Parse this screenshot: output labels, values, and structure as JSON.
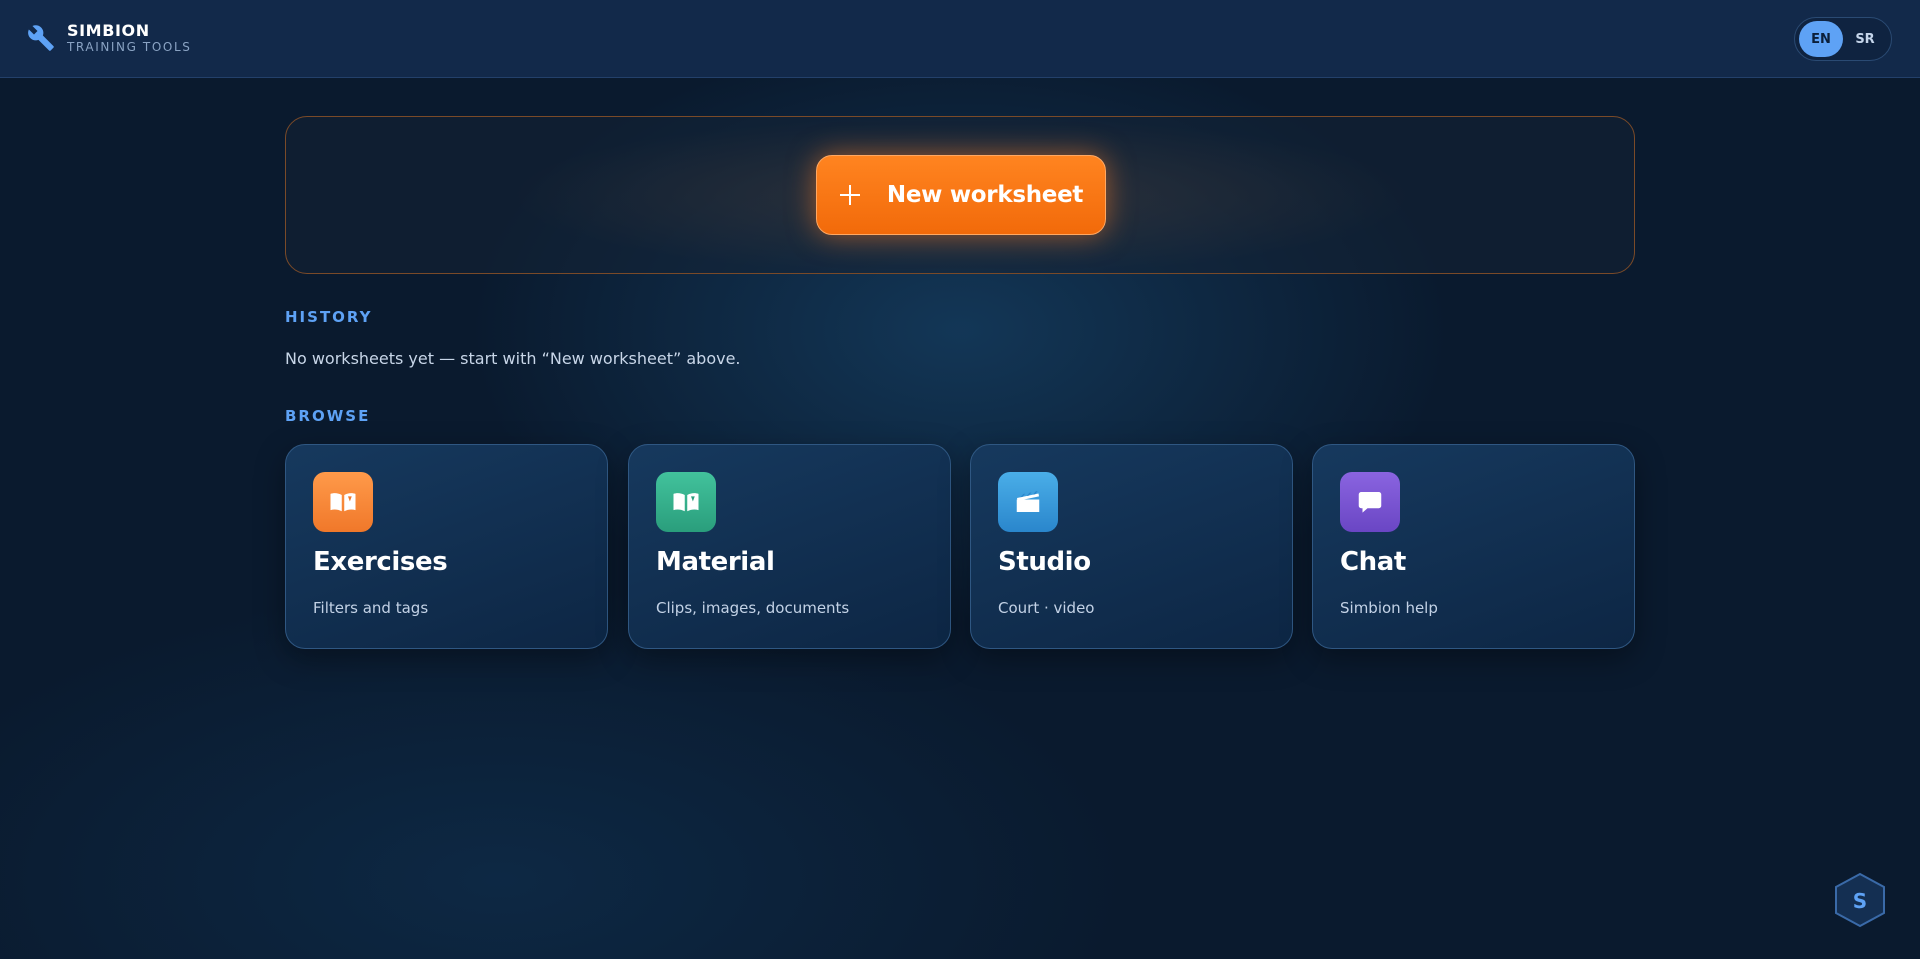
{
  "brand": {
    "title": "SIMBION",
    "subtitle": "TRAINING TOOLS",
    "icon": "wrench-icon"
  },
  "language": {
    "options": [
      {
        "code": "EN",
        "active": true
      },
      {
        "code": "SR",
        "active": false
      }
    ],
    "active_color": "#5ea2f5"
  },
  "hero": {
    "new_button_label": "New worksheet",
    "icon": "plus-icon",
    "accent": "#f97316"
  },
  "history": {
    "title": "HISTORY",
    "empty_text": "No worksheets yet — start with “New worksheet” above."
  },
  "browse": {
    "title": "BROWSE",
    "cards": [
      {
        "title": "Exercises",
        "subtitle": "Filters and tags",
        "icon": "book-icon",
        "color": "#f58a3a"
      },
      {
        "title": "Material",
        "subtitle": "Clips, images, documents",
        "icon": "book-icon",
        "color": "#36b08e"
      },
      {
        "title": "Studio",
        "subtitle": "Court · video",
        "icon": "clapperboard-icon",
        "color": "#3a9ce0"
      },
      {
        "title": "Chat",
        "subtitle": "Simbion help",
        "icon": "chat-bubble-icon",
        "color": "#7a54d4"
      }
    ]
  },
  "badge": {
    "letter": "S",
    "icon": "hexagon-icon"
  }
}
